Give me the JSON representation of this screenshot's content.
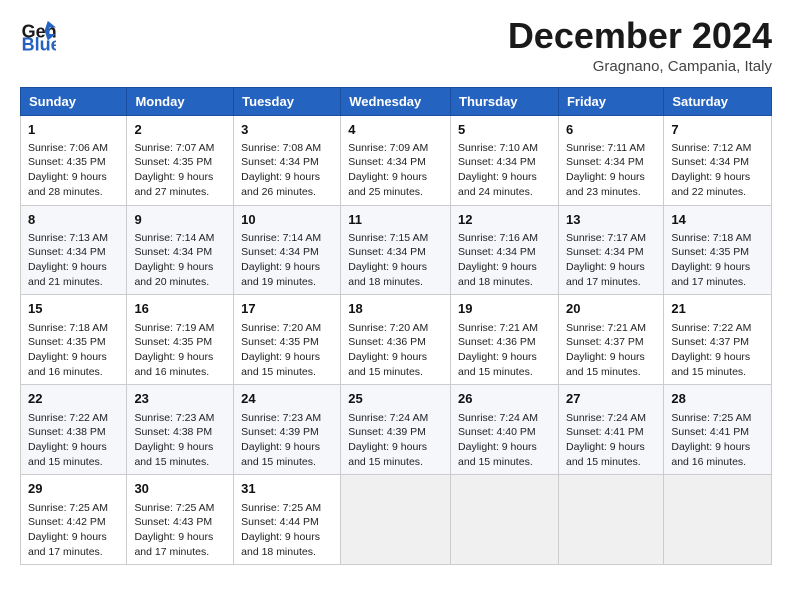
{
  "logo": {
    "line1": "General",
    "line2": "Blue"
  },
  "title": "December 2024",
  "location": "Gragnano, Campania, Italy",
  "headers": [
    "Sunday",
    "Monday",
    "Tuesday",
    "Wednesday",
    "Thursday",
    "Friday",
    "Saturday"
  ],
  "weeks": [
    [
      {
        "day": "1",
        "sunrise": "7:06 AM",
        "sunset": "4:35 PM",
        "daylight": "9 hours and 28 minutes."
      },
      {
        "day": "2",
        "sunrise": "7:07 AM",
        "sunset": "4:35 PM",
        "daylight": "9 hours and 27 minutes."
      },
      {
        "day": "3",
        "sunrise": "7:08 AM",
        "sunset": "4:34 PM",
        "daylight": "9 hours and 26 minutes."
      },
      {
        "day": "4",
        "sunrise": "7:09 AM",
        "sunset": "4:34 PM",
        "daylight": "9 hours and 25 minutes."
      },
      {
        "day": "5",
        "sunrise": "7:10 AM",
        "sunset": "4:34 PM",
        "daylight": "9 hours and 24 minutes."
      },
      {
        "day": "6",
        "sunrise": "7:11 AM",
        "sunset": "4:34 PM",
        "daylight": "9 hours and 23 minutes."
      },
      {
        "day": "7",
        "sunrise": "7:12 AM",
        "sunset": "4:34 PM",
        "daylight": "9 hours and 22 minutes."
      }
    ],
    [
      {
        "day": "8",
        "sunrise": "7:13 AM",
        "sunset": "4:34 PM",
        "daylight": "9 hours and 21 minutes."
      },
      {
        "day": "9",
        "sunrise": "7:14 AM",
        "sunset": "4:34 PM",
        "daylight": "9 hours and 20 minutes."
      },
      {
        "day": "10",
        "sunrise": "7:14 AM",
        "sunset": "4:34 PM",
        "daylight": "9 hours and 19 minutes."
      },
      {
        "day": "11",
        "sunrise": "7:15 AM",
        "sunset": "4:34 PM",
        "daylight": "9 hours and 18 minutes."
      },
      {
        "day": "12",
        "sunrise": "7:16 AM",
        "sunset": "4:34 PM",
        "daylight": "9 hours and 18 minutes."
      },
      {
        "day": "13",
        "sunrise": "7:17 AM",
        "sunset": "4:34 PM",
        "daylight": "9 hours and 17 minutes."
      },
      {
        "day": "14",
        "sunrise": "7:18 AM",
        "sunset": "4:35 PM",
        "daylight": "9 hours and 17 minutes."
      }
    ],
    [
      {
        "day": "15",
        "sunrise": "7:18 AM",
        "sunset": "4:35 PM",
        "daylight": "9 hours and 16 minutes."
      },
      {
        "day": "16",
        "sunrise": "7:19 AM",
        "sunset": "4:35 PM",
        "daylight": "9 hours and 16 minutes."
      },
      {
        "day": "17",
        "sunrise": "7:20 AM",
        "sunset": "4:35 PM",
        "daylight": "9 hours and 15 minutes."
      },
      {
        "day": "18",
        "sunrise": "7:20 AM",
        "sunset": "4:36 PM",
        "daylight": "9 hours and 15 minutes."
      },
      {
        "day": "19",
        "sunrise": "7:21 AM",
        "sunset": "4:36 PM",
        "daylight": "9 hours and 15 minutes."
      },
      {
        "day": "20",
        "sunrise": "7:21 AM",
        "sunset": "4:37 PM",
        "daylight": "9 hours and 15 minutes."
      },
      {
        "day": "21",
        "sunrise": "7:22 AM",
        "sunset": "4:37 PM",
        "daylight": "9 hours and 15 minutes."
      }
    ],
    [
      {
        "day": "22",
        "sunrise": "7:22 AM",
        "sunset": "4:38 PM",
        "daylight": "9 hours and 15 minutes."
      },
      {
        "day": "23",
        "sunrise": "7:23 AM",
        "sunset": "4:38 PM",
        "daylight": "9 hours and 15 minutes."
      },
      {
        "day": "24",
        "sunrise": "7:23 AM",
        "sunset": "4:39 PM",
        "daylight": "9 hours and 15 minutes."
      },
      {
        "day": "25",
        "sunrise": "7:24 AM",
        "sunset": "4:39 PM",
        "daylight": "9 hours and 15 minutes."
      },
      {
        "day": "26",
        "sunrise": "7:24 AM",
        "sunset": "4:40 PM",
        "daylight": "9 hours and 15 minutes."
      },
      {
        "day": "27",
        "sunrise": "7:24 AM",
        "sunset": "4:41 PM",
        "daylight": "9 hours and 15 minutes."
      },
      {
        "day": "28",
        "sunrise": "7:25 AM",
        "sunset": "4:41 PM",
        "daylight": "9 hours and 16 minutes."
      }
    ],
    [
      {
        "day": "29",
        "sunrise": "7:25 AM",
        "sunset": "4:42 PM",
        "daylight": "9 hours and 17 minutes."
      },
      {
        "day": "30",
        "sunrise": "7:25 AM",
        "sunset": "4:43 PM",
        "daylight": "9 hours and 17 minutes."
      },
      {
        "day": "31",
        "sunrise": "7:25 AM",
        "sunset": "4:44 PM",
        "daylight": "9 hours and 18 minutes."
      },
      null,
      null,
      null,
      null
    ]
  ],
  "labels": {
    "sunrise": "Sunrise:",
    "sunset": "Sunset:",
    "daylight": "Daylight:"
  }
}
